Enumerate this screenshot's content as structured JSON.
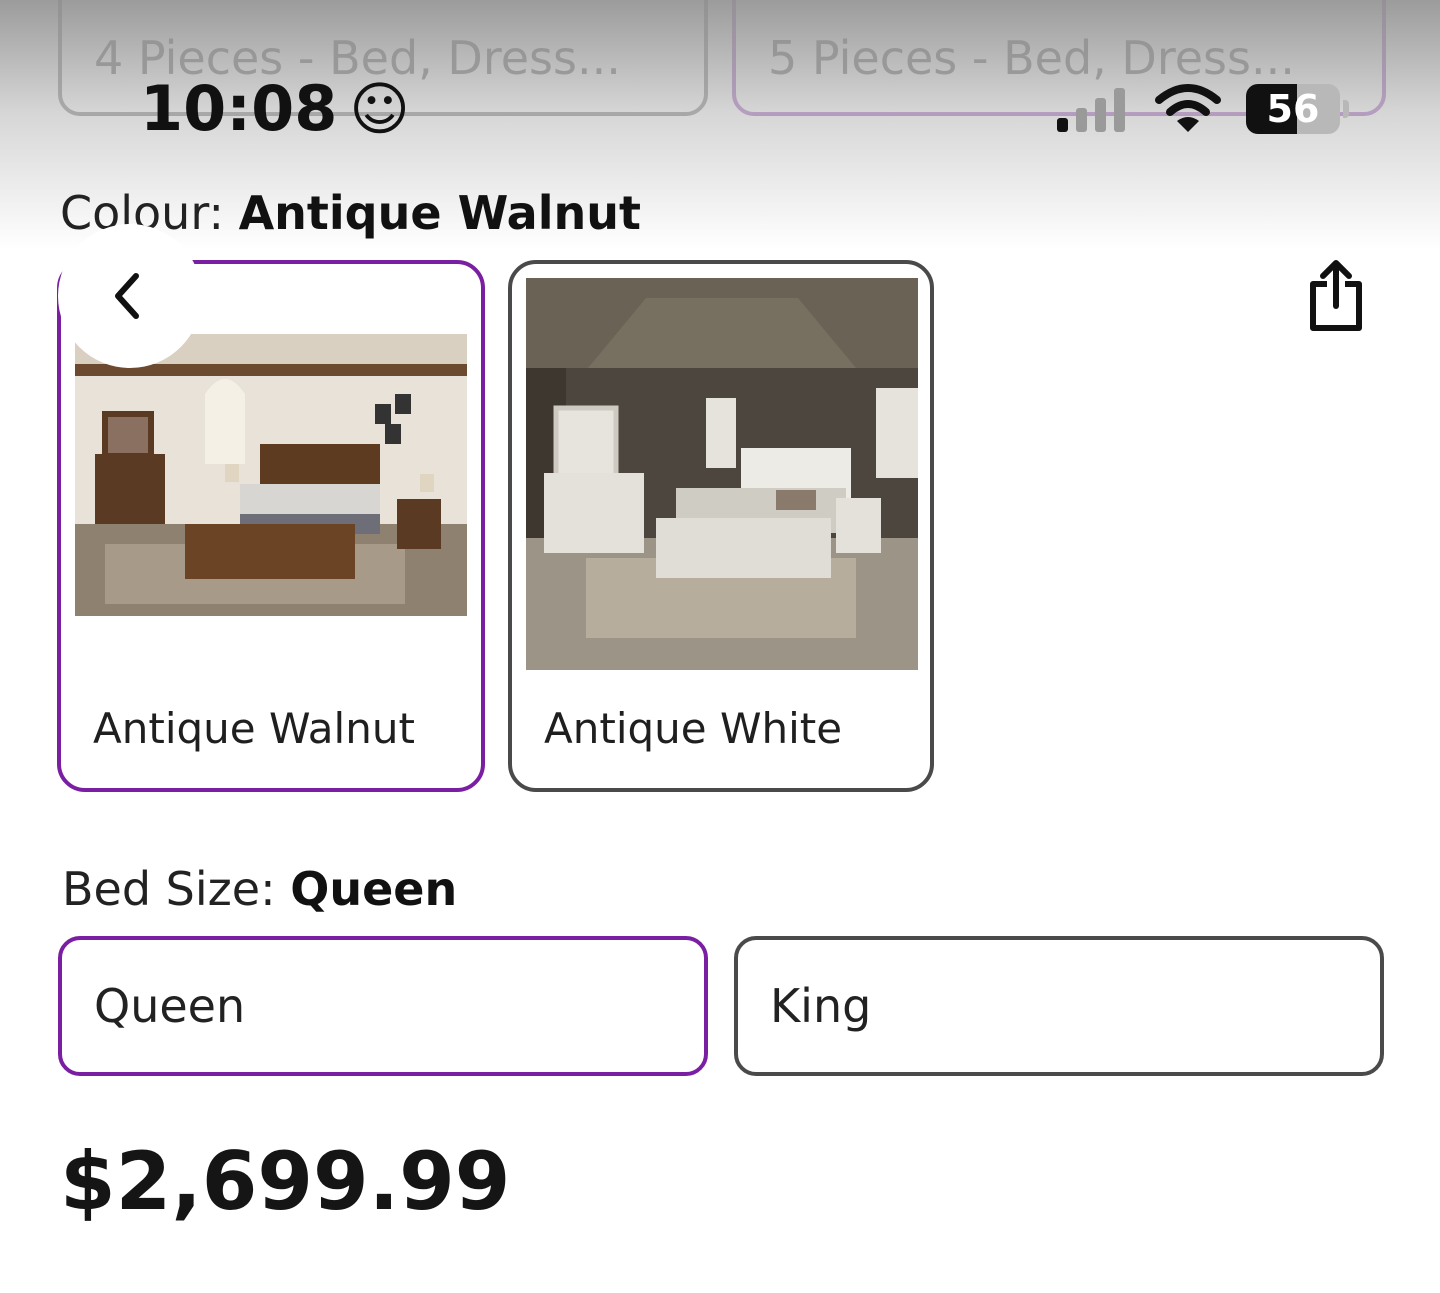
{
  "pieces_options": [
    {
      "label": "4 Pieces - Bed, Dress...",
      "selected": false
    },
    {
      "label": "5 Pieces - Bed, Dress...",
      "selected": true
    }
  ],
  "status_bar": {
    "time": "10:08",
    "time_emoji": "☺",
    "battery": "56"
  },
  "colour": {
    "label": "Colour:",
    "value": "Antique Walnut",
    "options": [
      {
        "name": "Antique Walnut",
        "selected": true
      },
      {
        "name": "Antique White",
        "selected": false
      }
    ]
  },
  "bed_size": {
    "label": "Bed Size:",
    "value": "Queen",
    "options": [
      {
        "name": "Queen",
        "selected": true
      },
      {
        "name": "King",
        "selected": false
      }
    ]
  },
  "price": "$2,699.99",
  "colors": {
    "accent": "#7b1fa2",
    "border": "#4a4a4a"
  },
  "icons": {
    "back": "chevron-left-icon",
    "share": "share-icon"
  }
}
